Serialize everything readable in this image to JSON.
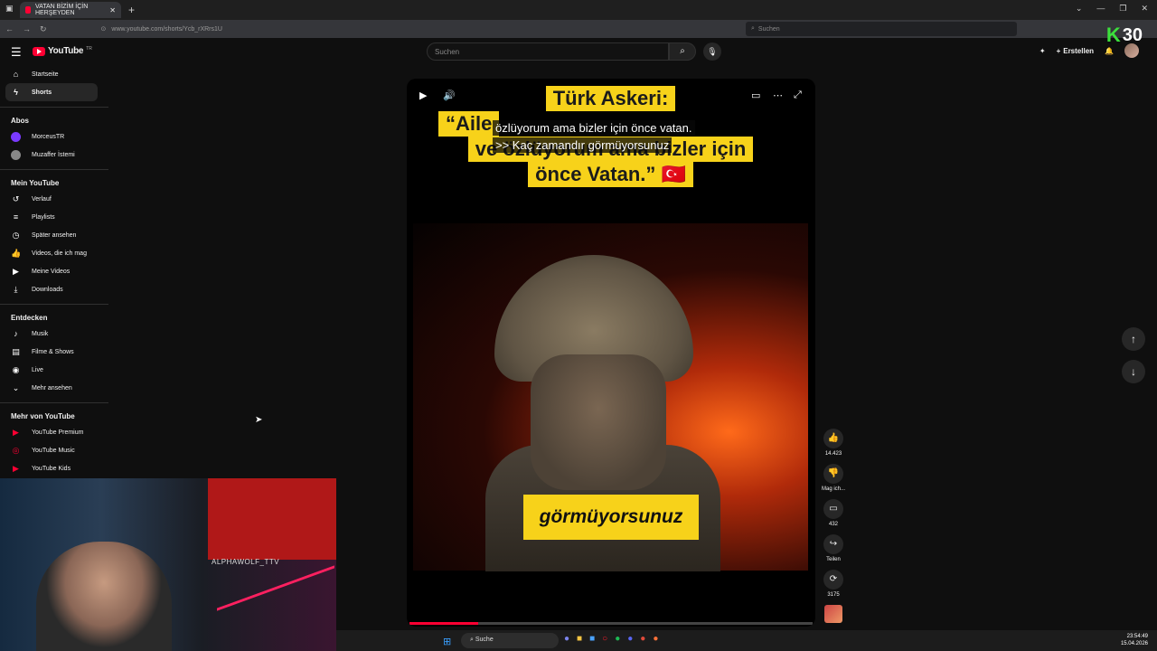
{
  "browser": {
    "tab_title": "VATAN BİZİM İÇİN HERŞEYDEN",
    "tab_close": "✕",
    "new_tab": "+",
    "url": "www.youtube.com/shorts/Ycb_rXRrs1U",
    "search_placeholder": "Suchen",
    "window_controls": [
      "⌄",
      "—",
      "❐",
      "✕"
    ]
  },
  "overlay_counter": {
    "k": "K",
    "number": "30"
  },
  "header": {
    "logo": "YouTube",
    "logo_suffix": "TR",
    "search_placeholder": "Suchen",
    "create_label": "Erstellen"
  },
  "sidebar": {
    "top": [
      {
        "label": "Startseite",
        "icon": "home-icon",
        "glyph": "⌂"
      },
      {
        "label": "Shorts",
        "icon": "shorts-icon",
        "glyph": "ϟ"
      }
    ],
    "abos_heading": "Abos",
    "subscriptions": [
      {
        "label": "MorceusTR",
        "color": "#7a3aff"
      },
      {
        "label": "Muzaffer İstemi",
        "color": "#888888"
      }
    ],
    "you_heading": "Mein YouTube",
    "you_items": [
      {
        "label": "Verlauf",
        "glyph": "↺"
      },
      {
        "label": "Playlists",
        "glyph": "≡"
      },
      {
        "label": "Später ansehen",
        "glyph": "◷"
      },
      {
        "label": "Videos, die ich mag",
        "glyph": "👍"
      },
      {
        "label": "Meine Videos",
        "glyph": "▶"
      },
      {
        "label": "Downloads",
        "glyph": "⤓"
      }
    ],
    "explore_heading": "Entdecken",
    "explore_items": [
      {
        "label": "Musik",
        "glyph": "♪"
      },
      {
        "label": "Filme & Shows",
        "glyph": "▤"
      },
      {
        "label": "Live",
        "glyph": "◉"
      },
      {
        "label": "Mehr ansehen",
        "glyph": "⌄"
      }
    ],
    "more_heading": "Mehr von YouTube",
    "more_items": [
      {
        "label": "YouTube Premium",
        "glyph": "▶"
      },
      {
        "label": "YouTube Music",
        "glyph": "◎"
      },
      {
        "label": "YouTube Kids",
        "glyph": "▶"
      }
    ]
  },
  "short": {
    "title_lines": [
      "Türk Askeri:",
      "“Aile",
      "ve özlüyorum ama bizler için",
      "önce Vatan.” 🇹🇷"
    ],
    "captions": [
      "özlüyorum ama bizler için önce vatan.",
      ">> Kaç zamandır görmüyorsunuz"
    ],
    "subtitle_word": "görmüyorsunuz",
    "progress": 0.17
  },
  "actions": [
    {
      "name": "like",
      "glyph": "👍",
      "label": "14.423"
    },
    {
      "name": "dislike",
      "glyph": "👎",
      "label": "Mag ich..."
    },
    {
      "name": "comments",
      "glyph": "▭",
      "label": "432"
    },
    {
      "name": "share",
      "glyph": "↪",
      "label": "Teilen"
    },
    {
      "name": "remix",
      "glyph": "⟳",
      "label": "3175"
    }
  ],
  "webcam": {
    "overlay_text": "ALPHAWOLF_TTV"
  },
  "taskbar": {
    "search_label": "Suche",
    "time": "23:54:49",
    "date": "15.04.2026"
  },
  "colors": {
    "accent": "#ff0033",
    "highlight": "#f7d21a",
    "background": "#0f0f0f"
  }
}
